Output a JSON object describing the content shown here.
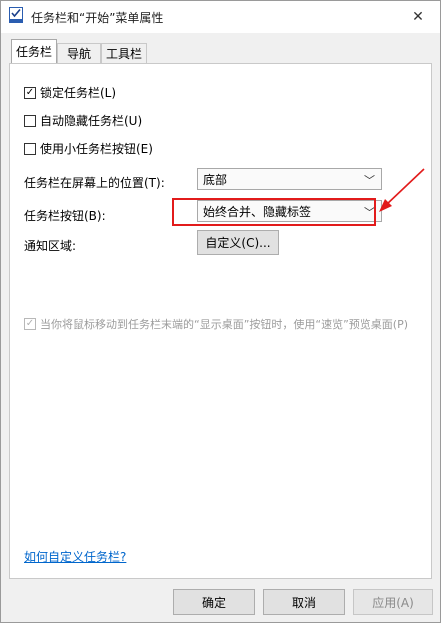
{
  "window": {
    "title": "任务栏和“开始”菜单属性",
    "close_glyph": "✕"
  },
  "tabs": [
    {
      "label": "任务栏",
      "active": true
    },
    {
      "label": "导航",
      "active": false
    },
    {
      "label": "工具栏",
      "active": false
    }
  ],
  "taskbar": {
    "lock_label": "锁定任务栏(L)",
    "lock_checked": true,
    "autohide_label": "自动隐藏任务栏(U)",
    "autohide_checked": false,
    "small_buttons_label": "使用小任务栏按钮(E)",
    "small_buttons_checked": false,
    "position_label": "任务栏在屏幕上的位置(T):",
    "position_value": "底部",
    "buttons_label": "任务栏按钮(B):",
    "buttons_value": "始终合并、隐藏标签",
    "notify_label": "通知区域:",
    "customize_label": "自定义(C)...",
    "peek_label": "当你将鼠标移动到任务栏末端的“显示桌面”按钮时，使用“速览”预览桌面(P)",
    "peek_checked": true,
    "peek_enabled": false,
    "help_link": "如何自定义任务栏?"
  },
  "footer": {
    "ok_label": "确定",
    "cancel_label": "取消",
    "apply_label": "应用(A)"
  },
  "colors": {
    "annotation": "#e21b1b",
    "link": "#0066cc"
  }
}
